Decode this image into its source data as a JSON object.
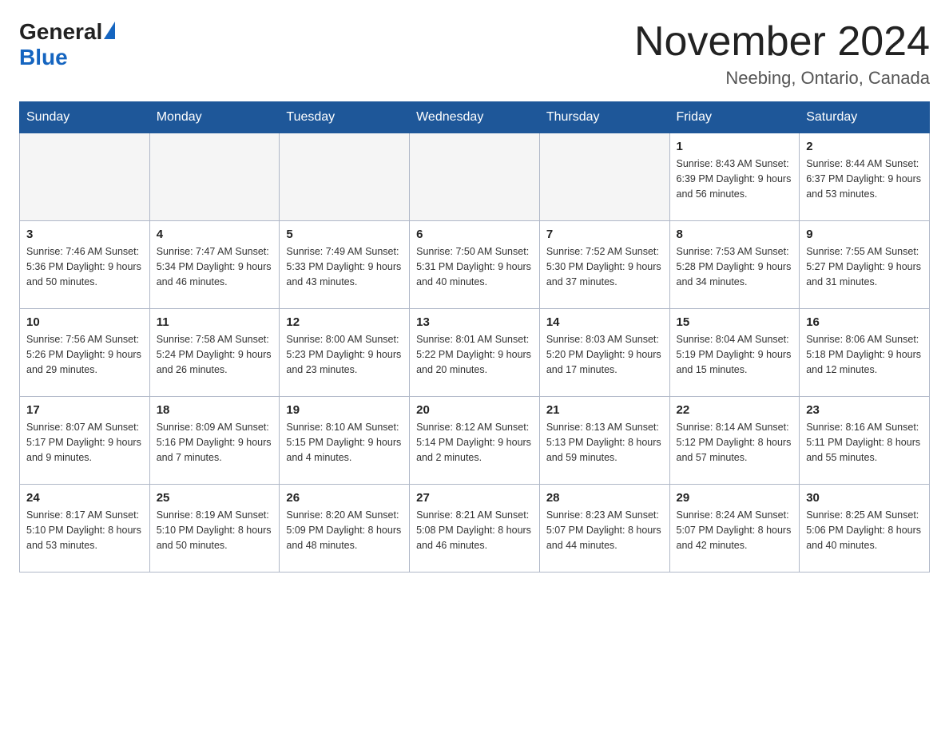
{
  "header": {
    "logo_general": "General",
    "logo_blue": "Blue",
    "month_title": "November 2024",
    "location": "Neebing, Ontario, Canada"
  },
  "weekdays": [
    "Sunday",
    "Monday",
    "Tuesday",
    "Wednesday",
    "Thursday",
    "Friday",
    "Saturday"
  ],
  "weeks": [
    [
      {
        "day": "",
        "info": ""
      },
      {
        "day": "",
        "info": ""
      },
      {
        "day": "",
        "info": ""
      },
      {
        "day": "",
        "info": ""
      },
      {
        "day": "",
        "info": ""
      },
      {
        "day": "1",
        "info": "Sunrise: 8:43 AM\nSunset: 6:39 PM\nDaylight: 9 hours\nand 56 minutes."
      },
      {
        "day": "2",
        "info": "Sunrise: 8:44 AM\nSunset: 6:37 PM\nDaylight: 9 hours\nand 53 minutes."
      }
    ],
    [
      {
        "day": "3",
        "info": "Sunrise: 7:46 AM\nSunset: 5:36 PM\nDaylight: 9 hours\nand 50 minutes."
      },
      {
        "day": "4",
        "info": "Sunrise: 7:47 AM\nSunset: 5:34 PM\nDaylight: 9 hours\nand 46 minutes."
      },
      {
        "day": "5",
        "info": "Sunrise: 7:49 AM\nSunset: 5:33 PM\nDaylight: 9 hours\nand 43 minutes."
      },
      {
        "day": "6",
        "info": "Sunrise: 7:50 AM\nSunset: 5:31 PM\nDaylight: 9 hours\nand 40 minutes."
      },
      {
        "day": "7",
        "info": "Sunrise: 7:52 AM\nSunset: 5:30 PM\nDaylight: 9 hours\nand 37 minutes."
      },
      {
        "day": "8",
        "info": "Sunrise: 7:53 AM\nSunset: 5:28 PM\nDaylight: 9 hours\nand 34 minutes."
      },
      {
        "day": "9",
        "info": "Sunrise: 7:55 AM\nSunset: 5:27 PM\nDaylight: 9 hours\nand 31 minutes."
      }
    ],
    [
      {
        "day": "10",
        "info": "Sunrise: 7:56 AM\nSunset: 5:26 PM\nDaylight: 9 hours\nand 29 minutes."
      },
      {
        "day": "11",
        "info": "Sunrise: 7:58 AM\nSunset: 5:24 PM\nDaylight: 9 hours\nand 26 minutes."
      },
      {
        "day": "12",
        "info": "Sunrise: 8:00 AM\nSunset: 5:23 PM\nDaylight: 9 hours\nand 23 minutes."
      },
      {
        "day": "13",
        "info": "Sunrise: 8:01 AM\nSunset: 5:22 PM\nDaylight: 9 hours\nand 20 minutes."
      },
      {
        "day": "14",
        "info": "Sunrise: 8:03 AM\nSunset: 5:20 PM\nDaylight: 9 hours\nand 17 minutes."
      },
      {
        "day": "15",
        "info": "Sunrise: 8:04 AM\nSunset: 5:19 PM\nDaylight: 9 hours\nand 15 minutes."
      },
      {
        "day": "16",
        "info": "Sunrise: 8:06 AM\nSunset: 5:18 PM\nDaylight: 9 hours\nand 12 minutes."
      }
    ],
    [
      {
        "day": "17",
        "info": "Sunrise: 8:07 AM\nSunset: 5:17 PM\nDaylight: 9 hours\nand 9 minutes."
      },
      {
        "day": "18",
        "info": "Sunrise: 8:09 AM\nSunset: 5:16 PM\nDaylight: 9 hours\nand 7 minutes."
      },
      {
        "day": "19",
        "info": "Sunrise: 8:10 AM\nSunset: 5:15 PM\nDaylight: 9 hours\nand 4 minutes."
      },
      {
        "day": "20",
        "info": "Sunrise: 8:12 AM\nSunset: 5:14 PM\nDaylight: 9 hours\nand 2 minutes."
      },
      {
        "day": "21",
        "info": "Sunrise: 8:13 AM\nSunset: 5:13 PM\nDaylight: 8 hours\nand 59 minutes."
      },
      {
        "day": "22",
        "info": "Sunrise: 8:14 AM\nSunset: 5:12 PM\nDaylight: 8 hours\nand 57 minutes."
      },
      {
        "day": "23",
        "info": "Sunrise: 8:16 AM\nSunset: 5:11 PM\nDaylight: 8 hours\nand 55 minutes."
      }
    ],
    [
      {
        "day": "24",
        "info": "Sunrise: 8:17 AM\nSunset: 5:10 PM\nDaylight: 8 hours\nand 53 minutes."
      },
      {
        "day": "25",
        "info": "Sunrise: 8:19 AM\nSunset: 5:10 PM\nDaylight: 8 hours\nand 50 minutes."
      },
      {
        "day": "26",
        "info": "Sunrise: 8:20 AM\nSunset: 5:09 PM\nDaylight: 8 hours\nand 48 minutes."
      },
      {
        "day": "27",
        "info": "Sunrise: 8:21 AM\nSunset: 5:08 PM\nDaylight: 8 hours\nand 46 minutes."
      },
      {
        "day": "28",
        "info": "Sunrise: 8:23 AM\nSunset: 5:07 PM\nDaylight: 8 hours\nand 44 minutes."
      },
      {
        "day": "29",
        "info": "Sunrise: 8:24 AM\nSunset: 5:07 PM\nDaylight: 8 hours\nand 42 minutes."
      },
      {
        "day": "30",
        "info": "Sunrise: 8:25 AM\nSunset: 5:06 PM\nDaylight: 8 hours\nand 40 minutes."
      }
    ]
  ]
}
